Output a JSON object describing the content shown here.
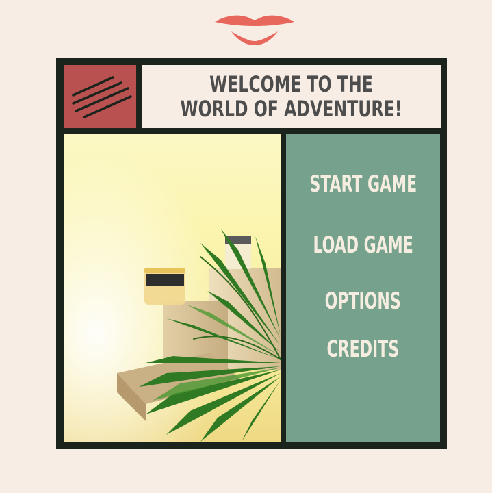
{
  "header": {
    "title_line1": "WELCOME TO THE",
    "title_line2": "WORLD OF ADVENTURE!"
  },
  "menu": {
    "items": [
      {
        "label": "START GAME"
      },
      {
        "label": "LOAD GAME"
      },
      {
        "label": "OPTIONS"
      },
      {
        "label": "CREDITS"
      }
    ]
  },
  "colors": {
    "background": "#f8ede5",
    "frame": "#1a231c",
    "accent_red": "#b8514f",
    "menu_panel": "#76a18c",
    "lips": "#e8675c",
    "title_text": "#4d4d4d",
    "menu_text": "#f6ede1"
  },
  "icons": [
    "lips-logo",
    "diagonal-stripes-icon"
  ],
  "image": {
    "subject": "cosmetic jars on podiums with palm leaf"
  }
}
